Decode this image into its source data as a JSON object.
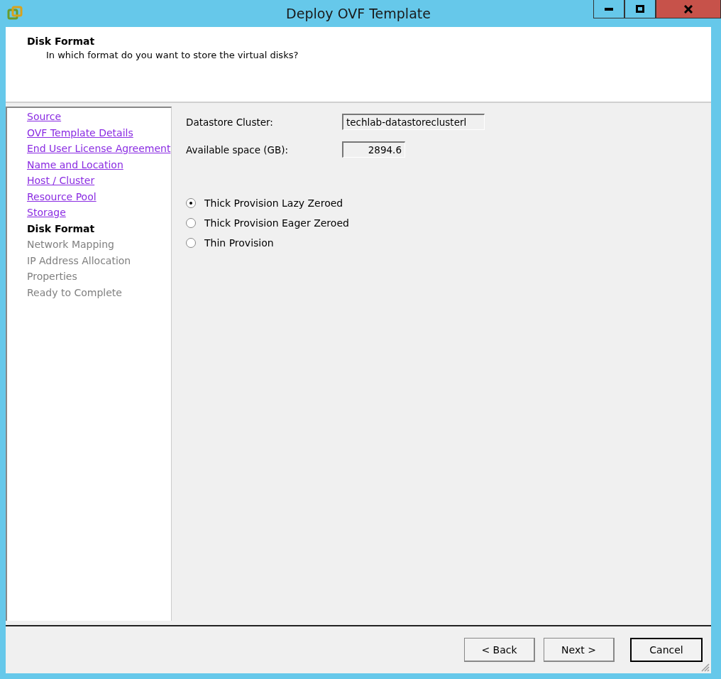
{
  "window": {
    "title": "Deploy OVF Template"
  },
  "header": {
    "title": "Disk Format",
    "subtitle": "In which format do you want to store the virtual disks?"
  },
  "steps": [
    {
      "label": "Source",
      "visited": true,
      "selected": false
    },
    {
      "label": "OVF Template Details",
      "visited": true,
      "selected": false
    },
    {
      "label": "End User License Agreement",
      "visited": true,
      "selected": false
    },
    {
      "label": "Name and Location",
      "visited": true,
      "selected": false
    },
    {
      "label": "Host / Cluster",
      "visited": true,
      "selected": false
    },
    {
      "label": "Resource Pool",
      "visited": true,
      "selected": false
    },
    {
      "label": "Storage",
      "visited": true,
      "selected": false
    },
    {
      "label": "Disk Format",
      "visited": false,
      "selected": true
    },
    {
      "label": "Network Mapping",
      "visited": false,
      "selected": false
    },
    {
      "label": "IP Address Allocation",
      "visited": false,
      "selected": false
    },
    {
      "label": "Properties",
      "visited": false,
      "selected": false
    },
    {
      "label": "Ready to Complete",
      "visited": false,
      "selected": false
    }
  ],
  "fields": [
    {
      "label": "Datastore Cluster:",
      "value": "techlab-datastoreclusterl",
      "kind": "text"
    },
    {
      "label": "Available space (GB):",
      "value": "2894.6",
      "kind": "number"
    }
  ],
  "options": [
    {
      "label": "Thick Provision Lazy Zeroed",
      "selected": true
    },
    {
      "label": "Thick Provision Eager Zeroed",
      "selected": false
    },
    {
      "label": "Thin Provision",
      "selected": false
    }
  ],
  "buttons": [
    {
      "label": "< Back",
      "kind": "normal"
    },
    {
      "label": "Next >",
      "kind": "normal"
    },
    {
      "label": "Cancel",
      "kind": "default"
    }
  ]
}
